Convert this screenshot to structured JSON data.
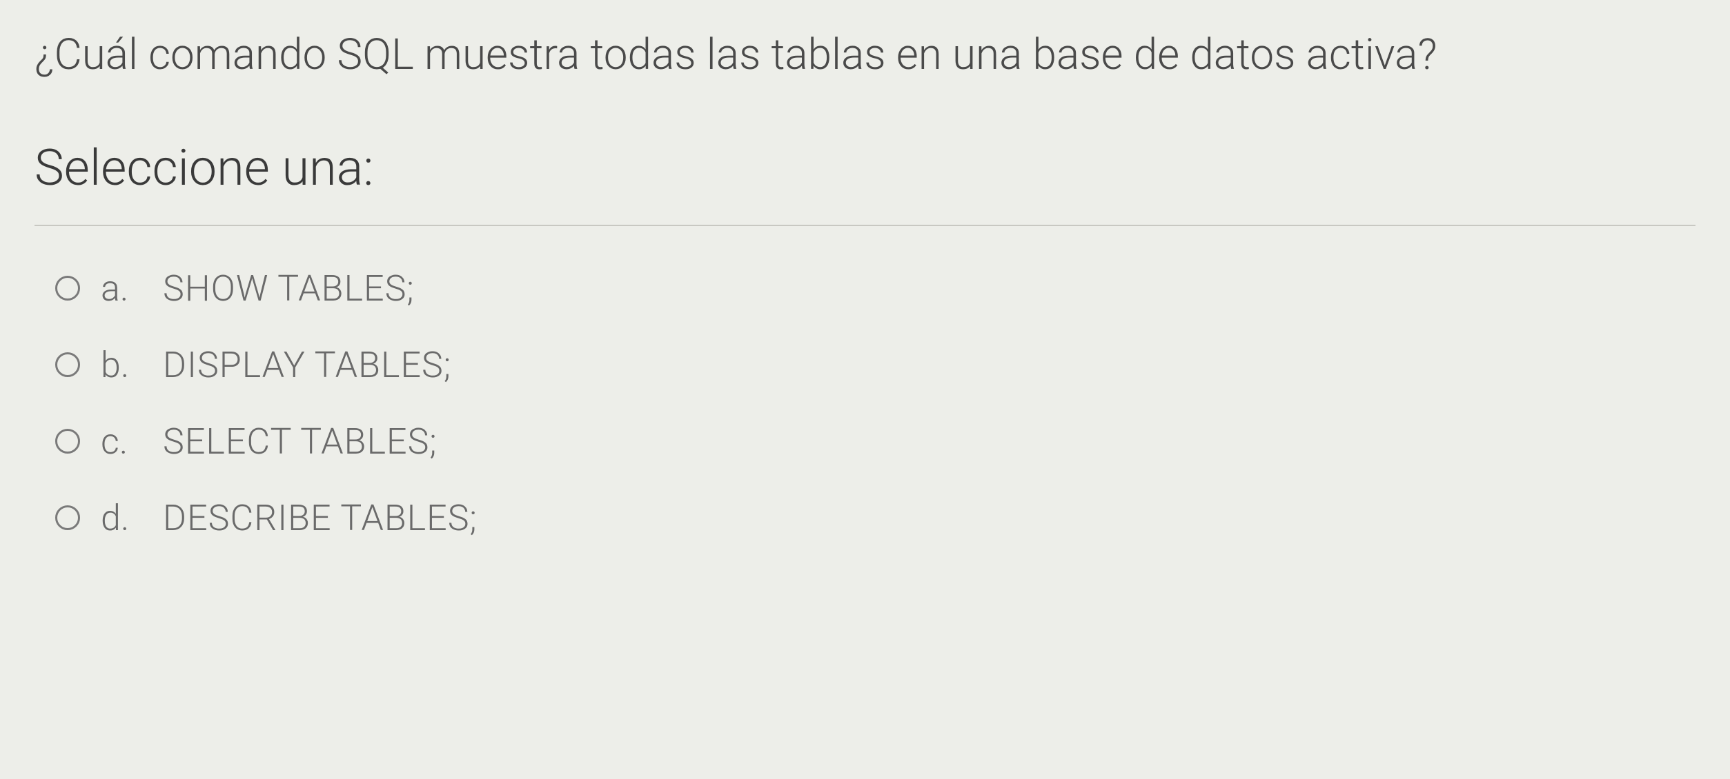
{
  "question": "¿Cuál comando SQL muestra todas las tablas en una base de datos activa?",
  "prompt": "Seleccione una:",
  "options": [
    {
      "letter": "a.",
      "text": "SHOW TABLES;"
    },
    {
      "letter": "b.",
      "text": "DISPLAY TABLES;"
    },
    {
      "letter": "c.",
      "text": "SELECT TABLES;"
    },
    {
      "letter": "d.",
      "text": "DESCRIBE TABLES;"
    }
  ]
}
